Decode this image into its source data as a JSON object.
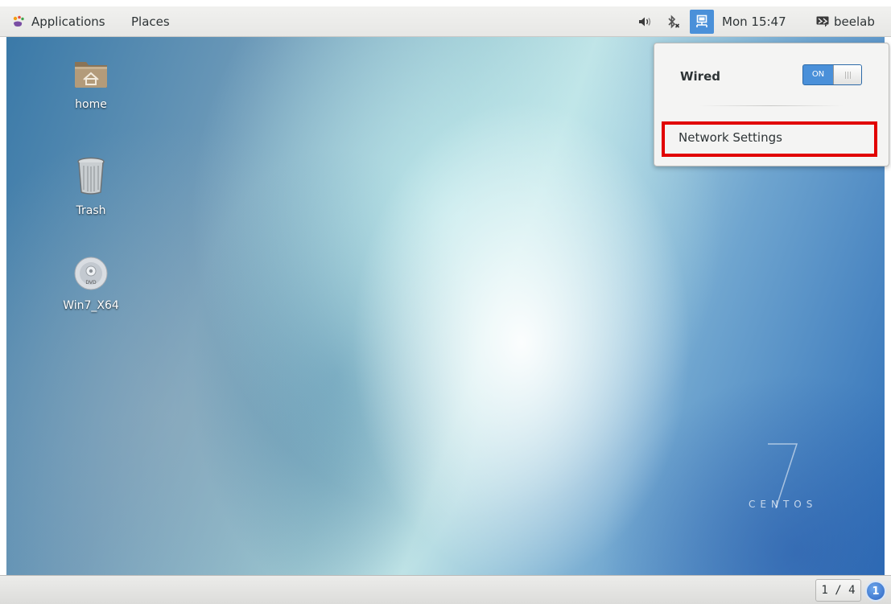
{
  "top_panel": {
    "applications_label": "Applications",
    "applications_icon": "gnome-foot-icon",
    "places_label": "Places",
    "volume_icon": "volume-icon",
    "bluetooth_icon": "bluetooth-disabled-icon",
    "network_icon": "wired-network-icon",
    "clock": "Mon 15:47",
    "user_icon": "user-session-icon",
    "user_name": "beelab",
    "accent_color": "#4a90d9"
  },
  "desktop": {
    "icons": [
      {
        "label": "home",
        "icon": "home-folder-icon"
      },
      {
        "label": "Trash",
        "icon": "trash-icon"
      },
      {
        "label": "Win7_X64",
        "icon": "dvd-icon"
      }
    ],
    "watermark": {
      "number": "7",
      "text": "CENTOS"
    }
  },
  "network_menu": {
    "wired_label": "Wired",
    "toggle_label": "ON",
    "toggle_state": "on",
    "settings_label": "Network Settings",
    "highlight_color": "#e10000"
  },
  "bottom_panel": {
    "workspace": "1 / 4",
    "notification_count": "1"
  }
}
